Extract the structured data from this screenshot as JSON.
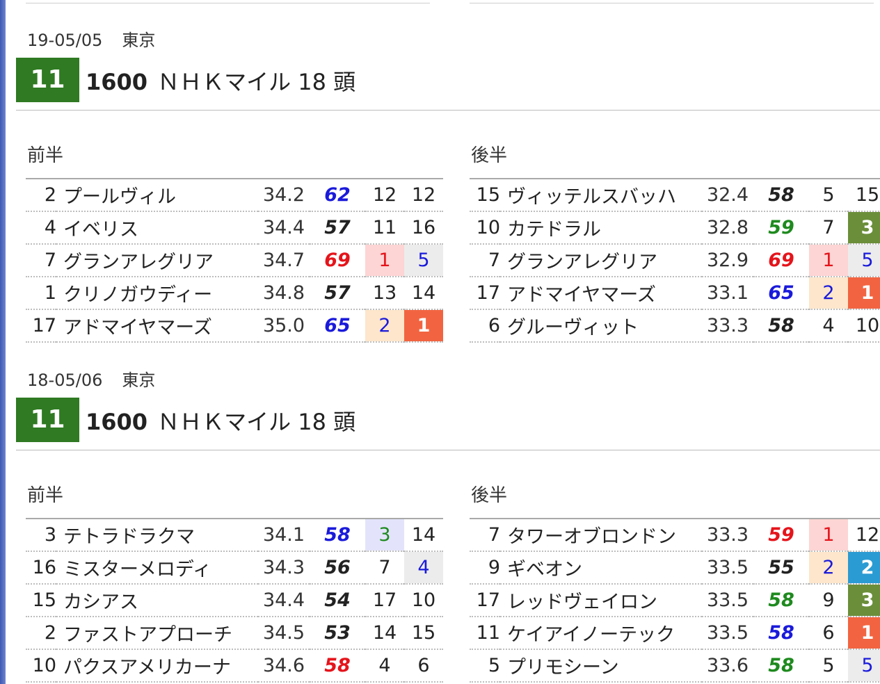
{
  "colors": {
    "race_no_bg": "#2f7a22",
    "blue": "#1a1adb",
    "red": "#e5141b",
    "green": "#1e8a1e",
    "black": "#222222",
    "rank1_bg": "#f26441",
    "rank2_bg": "#2b9bd3",
    "rank3_bg": "#6b8e3a",
    "pale_red_bg": "#fdd5d4",
    "pale_orange_bg": "#fde6cb",
    "pale_blue_bg": "#e3e4fb",
    "pale_gray_bg": "#ececec"
  },
  "races": [
    {
      "date": "19-05/05",
      "venue": "東京",
      "race_no": "11",
      "distance": "1600",
      "name": "ＮＨＫマイル",
      "runners": "18 頭",
      "first_half": {
        "label": "前半",
        "rows": [
          {
            "no": "2",
            "name": "プールヴィル",
            "time": "34.2",
            "index": "62",
            "index_color": "blue",
            "p1": "12",
            "p1_style": "plain",
            "p2": "12",
            "p2_style": "plain"
          },
          {
            "no": "4",
            "name": "イベリス",
            "time": "34.4",
            "index": "57",
            "index_color": "black",
            "p1": "11",
            "p1_style": "plain",
            "p2": "16",
            "p2_style": "plain"
          },
          {
            "no": "7",
            "name": "グランアレグリア",
            "time": "34.7",
            "index": "69",
            "index_color": "red",
            "p1": "1",
            "p1_style": "pale-red",
            "p2": "5",
            "p2_style": "pale-gray"
          },
          {
            "no": "1",
            "name": "クリノガウディー",
            "time": "34.8",
            "index": "57",
            "index_color": "black",
            "p1": "13",
            "p1_style": "plain",
            "p2": "14",
            "p2_style": "plain"
          },
          {
            "no": "17",
            "name": "アドマイヤマーズ",
            "time": "35.0",
            "index": "65",
            "index_color": "blue",
            "p1": "2",
            "p1_style": "pale-orange",
            "p2": "1",
            "p2_style": "rank1"
          }
        ]
      },
      "second_half": {
        "label": "後半",
        "rows": [
          {
            "no": "15",
            "name": "ヴィッテルスバッハ",
            "time": "32.4",
            "index": "58",
            "index_color": "black",
            "p1": "5",
            "p1_style": "plain",
            "p2": "15",
            "p2_style": "plain"
          },
          {
            "no": "10",
            "name": "カテドラル",
            "time": "32.8",
            "index": "59",
            "index_color": "green",
            "p1": "7",
            "p1_style": "plain",
            "p2": "3",
            "p2_style": "rank3"
          },
          {
            "no": "7",
            "name": "グランアレグリア",
            "time": "32.9",
            "index": "69",
            "index_color": "red",
            "p1": "1",
            "p1_style": "pale-red",
            "p2": "5",
            "p2_style": "pale-gray"
          },
          {
            "no": "17",
            "name": "アドマイヤマーズ",
            "time": "33.1",
            "index": "65",
            "index_color": "blue",
            "p1": "2",
            "p1_style": "pale-orange",
            "p2": "1",
            "p2_style": "rank1"
          },
          {
            "no": "6",
            "name": "グルーヴィット",
            "time": "33.3",
            "index": "58",
            "index_color": "black",
            "p1": "4",
            "p1_style": "plain",
            "p2": "10",
            "p2_style": "plain"
          }
        ]
      }
    },
    {
      "date": "18-05/06",
      "venue": "東京",
      "race_no": "11",
      "distance": "1600",
      "name": "ＮＨＫマイル",
      "runners": "18 頭",
      "first_half": {
        "label": "前半",
        "rows": [
          {
            "no": "3",
            "name": "テトラドラクマ",
            "time": "34.1",
            "index": "58",
            "index_color": "blue",
            "p1": "3",
            "p1_style": "pale-blue",
            "p2": "14",
            "p2_style": "plain"
          },
          {
            "no": "16",
            "name": "ミスターメロディ",
            "time": "34.3",
            "index": "56",
            "index_color": "black",
            "p1": "7",
            "p1_style": "plain",
            "p2": "4",
            "p2_style": "pale-gray"
          },
          {
            "no": "15",
            "name": "カシアス",
            "time": "34.4",
            "index": "54",
            "index_color": "black",
            "p1": "17",
            "p1_style": "plain",
            "p2": "10",
            "p2_style": "plain"
          },
          {
            "no": "2",
            "name": "ファストアプローチ",
            "time": "34.5",
            "index": "53",
            "index_color": "black",
            "p1": "14",
            "p1_style": "plain",
            "p2": "15",
            "p2_style": "plain"
          },
          {
            "no": "10",
            "name": "パクスアメリカーナ",
            "time": "34.6",
            "index": "58",
            "index_color": "red",
            "p1": "4",
            "p1_style": "plain",
            "p2": "6",
            "p2_style": "plain"
          }
        ]
      },
      "second_half": {
        "label": "後半",
        "rows": [
          {
            "no": "7",
            "name": "タワーオブロンドン",
            "time": "33.3",
            "index": "59",
            "index_color": "red",
            "p1": "1",
            "p1_style": "pale-red",
            "p2": "12",
            "p2_style": "plain"
          },
          {
            "no": "9",
            "name": "ギベオン",
            "time": "33.5",
            "index": "55",
            "index_color": "black",
            "p1": "2",
            "p1_style": "pale-orange",
            "p2": "2",
            "p2_style": "rank2"
          },
          {
            "no": "17",
            "name": "レッドヴェイロン",
            "time": "33.5",
            "index": "58",
            "index_color": "green",
            "p1": "9",
            "p1_style": "plain",
            "p2": "3",
            "p2_style": "rank3"
          },
          {
            "no": "11",
            "name": "ケイアイノーテック",
            "time": "33.5",
            "index": "58",
            "index_color": "blue",
            "p1": "6",
            "p1_style": "plain",
            "p2": "1",
            "p2_style": "rank1"
          },
          {
            "no": "5",
            "name": "プリモシーン",
            "time": "33.6",
            "index": "58",
            "index_color": "green",
            "p1": "5",
            "p1_style": "plain",
            "p2": "5",
            "p2_style": "pale-gray"
          }
        ]
      }
    }
  ]
}
